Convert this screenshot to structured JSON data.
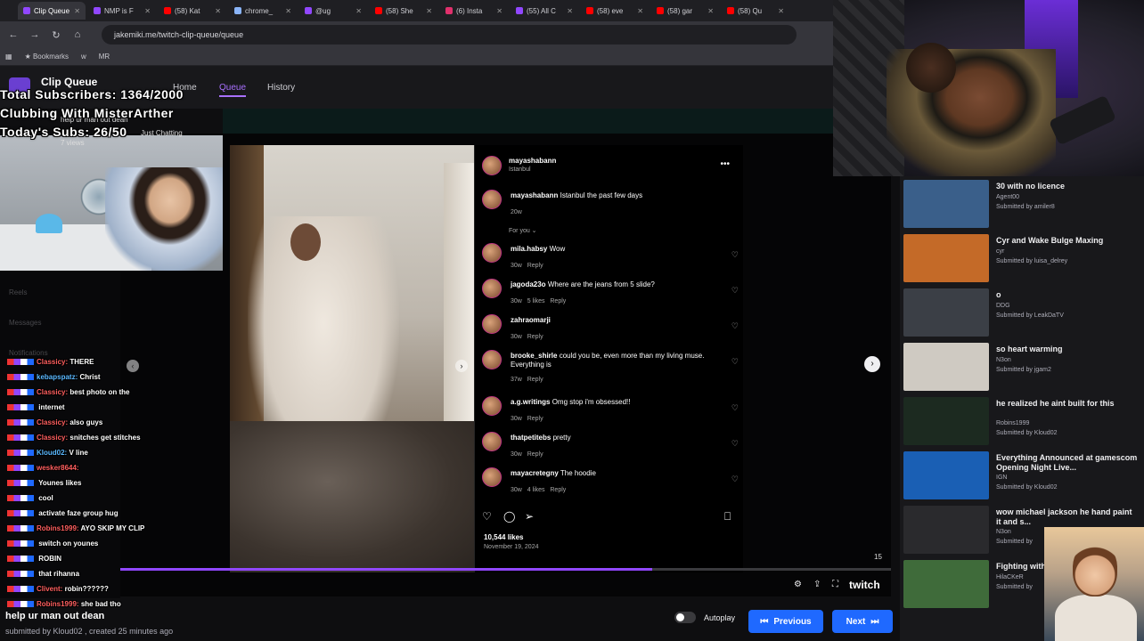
{
  "browser": {
    "tabs": [
      {
        "label": "Clip Queue",
        "color": "#9147ff",
        "active": true
      },
      {
        "label": "NMP is F",
        "color": "#9147ff"
      },
      {
        "label": "(58) Kat",
        "color": "#ff0000"
      },
      {
        "label": "chrome_",
        "color": "#8ab4f8"
      },
      {
        "label": "@ug",
        "color": "#9147ff"
      },
      {
        "label": "(58) She",
        "color": "#ff0000"
      },
      {
        "label": "(6) Insta",
        "color": "#e1306c"
      },
      {
        "label": "(55) All C",
        "color": "#9147ff"
      },
      {
        "label": "(58) eve",
        "color": "#ff0000"
      },
      {
        "label": "(58) gar",
        "color": "#ff0000"
      },
      {
        "label": "(58) Qu",
        "color": "#ff0000"
      }
    ],
    "url": "jakemiki.me/twitch-clip-queue/queue",
    "bookmarks": [
      "Bookmarks",
      "w",
      "MR"
    ]
  },
  "site": {
    "title": "Clip Queue",
    "nav": [
      "Home",
      "Queue",
      "History"
    ]
  },
  "overlay": {
    "total_subs": "Total Subscribers: 1364/2000",
    "stream_title": "Clubbing With MisterArther",
    "todays_subs": "Today's Subs: 26/50"
  },
  "clip_header": {
    "title": "help ur man out dean",
    "category": "Just Chatting",
    "views": "7 views"
  },
  "left_panel": {
    "items": [
      "Reels",
      "Messages",
      "Notifications"
    ]
  },
  "chat": [
    {
      "user": "Classicy:",
      "color": "#ff5f5f",
      "msg": "THERE"
    },
    {
      "user": "kebapspatz:",
      "color": "#5ab8ff",
      "msg": "Christ"
    },
    {
      "user": "Classicy:",
      "color": "#ff5f5f",
      "msg": "best photo on the"
    },
    {
      "user": "",
      "color": "#ffffff",
      "msg": "internet"
    },
    {
      "user": "Classicy:",
      "color": "#ff5f5f",
      "msg": "also guys"
    },
    {
      "user": "Classicy:",
      "color": "#ff5f5f",
      "msg": "snitches get stitches"
    },
    {
      "user": "Kloud02:",
      "color": "#5ab8ff",
      "msg": "V line"
    },
    {
      "user": "wesker8644:",
      "color": "#ff5f5f",
      "msg": ""
    },
    {
      "user": "",
      "color": "#ffffff",
      "msg": "Younes likes"
    },
    {
      "user": "",
      "color": "#2ecc71",
      "msg": "cool"
    },
    {
      "user": "",
      "color": "#ff5f5f",
      "msg": "activate faze group hug"
    },
    {
      "user": "Robins1999:",
      "color": "#ff5f5f",
      "msg": "AYO SKIP MY CLIP"
    },
    {
      "user": "",
      "color": "#ffffff",
      "msg": "switch on younes"
    },
    {
      "user": "",
      "color": "#ff5f5f",
      "msg": "ROBIN"
    },
    {
      "user": "",
      "color": "#ffffff",
      "msg": "that rihanna"
    },
    {
      "user": "Clivent:",
      "color": "#ff5f5f",
      "msg": "robin??????"
    },
    {
      "user": "Robins1999:",
      "color": "#ff5f5f",
      "msg": "she bad tho"
    }
  ],
  "post": {
    "username": "mayashabann",
    "location": "Istanbul",
    "caption_user": "mayashabann",
    "caption": "Istanbul the past few days",
    "caption_time": "20w",
    "for_you": "For you",
    "comments": [
      {
        "user": "mila.habsy",
        "text": "Wow",
        "time": "30w",
        "likes": "",
        "reply": "Reply"
      },
      {
        "user": "jagoda23o",
        "text": "Where are the jeans from 5 slide?",
        "time": "30w",
        "likes": "5 likes",
        "reply": "Reply"
      },
      {
        "user": "zahraomarji",
        "text": "",
        "time": "30w",
        "likes": "",
        "reply": "Reply"
      },
      {
        "user": "brooke_shirle",
        "text": "could you be, even more than my living muse. Everything is",
        "time": "37w",
        "likes": "",
        "reply": "Reply"
      },
      {
        "user": "a.g.writings",
        "text": "Omg stop i'm obsessed!!",
        "time": "30w",
        "likes": "",
        "reply": "Reply"
      },
      {
        "user": "thatpetitebs",
        "text": "pretty",
        "time": "30w",
        "likes": "",
        "reply": "Reply"
      },
      {
        "user": "mayacretegny",
        "text": "The hoodie",
        "time": "30w",
        "likes": "4 likes",
        "reply": "Reply"
      }
    ],
    "likes": "10,544 likes",
    "date": "November 19, 2024"
  },
  "player": {
    "progress": 0.69,
    "counter": "15",
    "brand": "twitch"
  },
  "bottom": {
    "clip_title": "help ur man out dean",
    "submitted_by": "submitted by Kloud02 , created 25 minutes ago",
    "autoplay": "Autoplay",
    "previous": "Previous",
    "next": "Next"
  },
  "queue": [
    {
      "title": "30 with no licence",
      "channel": "Agent00",
      "submitter": "Submitted by amiler8",
      "thumb": "#3a5f8a"
    },
    {
      "title": "Cyr and Wake Bulge Maxing",
      "channel": "cyr",
      "submitter": "Submitted by luisa_delrey",
      "thumb": "#c46a28"
    },
    {
      "title": "o",
      "channel": "DDG",
      "submitter": "Submitted by LeakDaTV",
      "thumb": "#3b3f46"
    },
    {
      "title": "so heart warming",
      "channel": "N3on",
      "submitter": "Submitted by jgam2",
      "thumb": "#cfcac2"
    },
    {
      "title": "he realized he aint built for this",
      "channel": "Robins1999",
      "submitter": "Submitted by Kloud02",
      "thumb": "#1c2a20"
    },
    {
      "title": "Everything Announced at gamescom Opening Night Live...",
      "channel": "IGN",
      "submitter": "Submitted by Kloud02",
      "thumb": "#1a5fb4"
    },
    {
      "title": "wow michael jackson he hand paint it and s...",
      "channel": "N3on",
      "submitter": "Submitted by",
      "thumb": "#2a2a2d"
    },
    {
      "title": "Fighting with Resident Evil",
      "channel": "HilaCKeR",
      "submitter": "Submitted by",
      "thumb": "#3f6b3a"
    }
  ]
}
